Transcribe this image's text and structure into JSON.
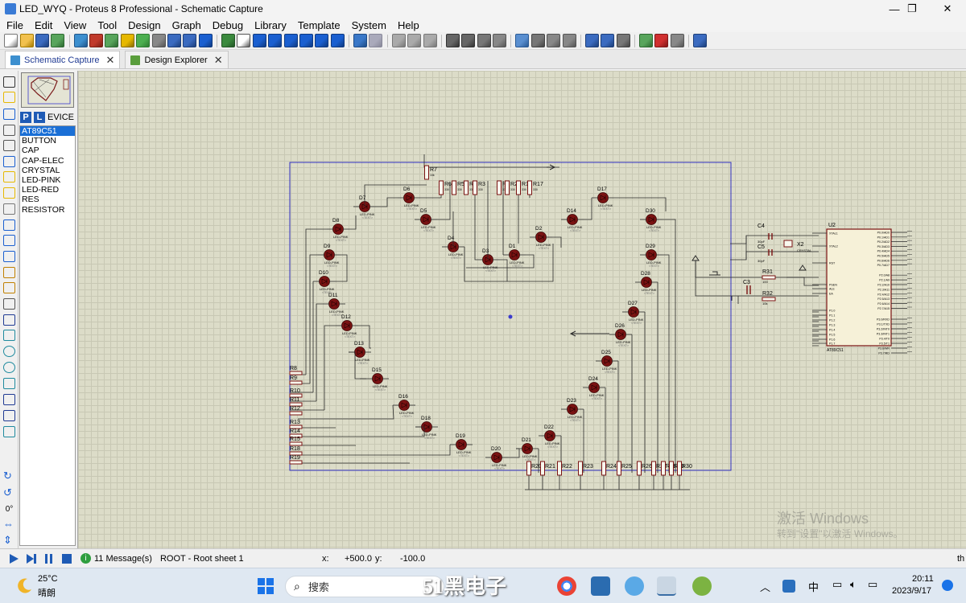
{
  "window": {
    "title": "LED_WYQ - Proteus 8 Professional - Schematic Capture",
    "controls": [
      "—",
      "❐",
      "✕"
    ]
  },
  "menu": [
    "File",
    "Edit",
    "View",
    "Tool",
    "Design",
    "Graph",
    "Debug",
    "Library",
    "Template",
    "System",
    "Help"
  ],
  "tabs": [
    {
      "label": "Schematic Capture",
      "active": true
    },
    {
      "label": "Design Explorer",
      "active": false
    }
  ],
  "device_panel": {
    "p_button": "P",
    "l_button": "L",
    "header": "EVICE",
    "items": [
      "AT89C51",
      "BUTTON",
      "CAP",
      "CAP-ELEC",
      "CRYSTAL",
      "LED-PINK",
      "LED-RED",
      "RES",
      "RESISTOR"
    ],
    "selected": "AT89C51"
  },
  "rotation": "0°",
  "status": {
    "messages": "11 Message(s)",
    "sheet": "ROOT - Root sheet 1",
    "x_label": "x:",
    "x_value": "+500.0",
    "y_label": "y:",
    "y_value": "-100.0",
    "trailing": "th"
  },
  "watermark": {
    "line1": "激活 Windows",
    "line2": "转到\"设置\"以激活 Windows。"
  },
  "schematic": {
    "led_type": "LED-PINK",
    "text_tag": "<TEXT>",
    "mcu_ref": "U2",
    "mcu_name": "AT89C51",
    "leds": [
      {
        "ref": "D7"
      },
      {
        "ref": "D6"
      },
      {
        "ref": "D5"
      },
      {
        "ref": "D8"
      },
      {
        "ref": "D9"
      },
      {
        "ref": "D10"
      },
      {
        "ref": "D11"
      },
      {
        "ref": "D12"
      },
      {
        "ref": "D13"
      },
      {
        "ref": "D15"
      },
      {
        "ref": "D16"
      },
      {
        "ref": "D18"
      },
      {
        "ref": "D19"
      },
      {
        "ref": "D20"
      },
      {
        "ref": "D21"
      },
      {
        "ref": "D22"
      },
      {
        "ref": "D23"
      },
      {
        "ref": "D24"
      },
      {
        "ref": "D25"
      },
      {
        "ref": "D26"
      },
      {
        "ref": "D27"
      },
      {
        "ref": "D28"
      },
      {
        "ref": "D29"
      },
      {
        "ref": "D30"
      },
      {
        "ref": "D17"
      },
      {
        "ref": "D14"
      },
      {
        "ref": "D2"
      },
      {
        "ref": "D1"
      },
      {
        "ref": "D3"
      },
      {
        "ref": "D4"
      }
    ],
    "top_resistors": [
      "R7",
      "R6",
      "R5",
      "R4",
      "R3",
      "R1",
      "R2",
      "R16",
      "R17"
    ],
    "left_resistors": [
      "R8",
      "R9",
      "R10",
      "R11",
      "R12",
      "R13",
      "R14",
      "R15",
      "R18",
      "R19"
    ],
    "bottom_resistors": [
      "R20",
      "R21",
      "R22",
      "R23",
      "R24",
      "R25",
      "R26",
      "R27",
      "R28",
      "R29",
      "R30"
    ],
    "parts": [
      {
        "ref": "C4",
        "value": "30pF"
      },
      {
        "ref": "C5",
        "value": "30pF"
      },
      {
        "ref": "X2",
        "value": "CRYSTAL"
      },
      {
        "ref": "C3",
        "value": ""
      },
      {
        "ref": "R31",
        "value": "100"
      },
      {
        "ref": "R32",
        "value": "10k"
      }
    ],
    "r7_value": "10k",
    "res_value": "330",
    "mcu_left_pins": [
      "XTAL1",
      "XTAL2",
      "RST",
      "PSEN",
      "ALE",
      "EA",
      "P1.0",
      "P1.1",
      "P1.2",
      "P1.3",
      "P1.4",
      "P1.5",
      "P1.6",
      "P1.7"
    ],
    "mcu_right_pins": [
      "P0.0/AD0",
      "P0.1/AD1",
      "P0.2/AD2",
      "P0.3/AD3",
      "P0.4/AD4",
      "P0.5/AD5",
      "P0.6/AD6",
      "P0.7/AD7",
      "P2.0/A8",
      "P2.1/A9",
      "P2.2/A10",
      "P2.3/A11",
      "P2.4/A12",
      "P2.5/A13",
      "P2.6/A14",
      "P2.7/A15",
      "P3.0/RXD",
      "P3.1/TXD",
      "P3.2/INT0",
      "P3.3/INT1",
      "P3.4/T0",
      "P3.5/T1",
      "P3.6/WR",
      "P3.7/RD"
    ]
  },
  "taskbar": {
    "weather_temp": "25°C",
    "weather_desc": "晴朗",
    "search_placeholder": "搜索",
    "ime": "中",
    "time": "20:11",
    "date": "2023/9/17",
    "logo_text": "51黑电子"
  }
}
